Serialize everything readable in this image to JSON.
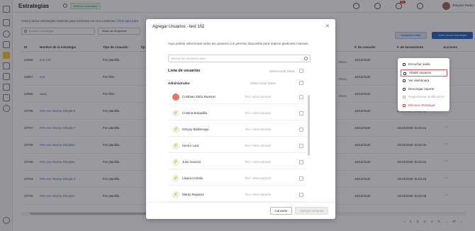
{
  "header": {
    "title": "Estrategias",
    "status_badge": "Teléfono conectado",
    "notification_count": "29",
    "user_name": "Jheyson Pedro"
  },
  "subtitle": {
    "text": "Crea y lanza estrategias masivas para contactar con tus contactos.",
    "link": "Click aquí para"
  },
  "filters": {
    "search_placeholder": "Busca tu estrategia",
    "type_select": "Todas las empresas"
  },
  "actions": {
    "update_label": "Actualizar tabla",
    "create_label": "Crear nueva estrategia"
  },
  "table": {
    "headers": [
      "ID",
      "Nombre de la estrategia",
      "Tipo de creación",
      "Tip",
      "F. de creación",
      "F. de lanzamiento",
      "Acciones"
    ],
    "rows": [
      {
        "id": "22868",
        "name": "test 102",
        "type": "Por plantilla",
        "created": "15/10/2025",
        "launched": "",
        "creator_extra": "Alfaro"
      },
      {
        "id": "22867",
        "name": "test",
        "type": "Por filtro",
        "created": "15/10/2025",
        "launched": "",
        "creator_extra": "Alfaro"
      },
      {
        "id": "22866",
        "name": "aaaa",
        "type": "Por filtro",
        "created": "15/10/2025",
        "launched": "",
        "creator_extra": "Alfaro"
      },
      {
        "id": "22708",
        "name": "IVR con retorno Sheyla 8",
        "type": "Por plantilla",
        "created": "15/10/2025",
        "launched": "15/10/2025 15:52:48",
        "creator_extra": ""
      },
      {
        "id": "22707",
        "name": "IVR con retorno Sheyla 7",
        "type": "Por plantilla",
        "created": "15/10/2025",
        "launched": "15/10/2025 15:52:41",
        "creator_extra": ""
      },
      {
        "id": "22706",
        "name": "IVR con retorno Sheyla6",
        "type": "Por plantilla",
        "created": "15/10/2025",
        "launched": "15/10/2025 15:53:32",
        "creator_extra": ""
      },
      {
        "id": "22705",
        "name": "IVR con retorno Sheyla5",
        "type": "Por plantilla",
        "created": "15/10/2025",
        "launched": "15/10/2025 15:53:24",
        "creator_extra": ""
      },
      {
        "id": "22704",
        "name": "IVR con retorno Sheyla 3",
        "type": "Por plantilla",
        "created": "15/10/2025",
        "launched": "15/10/2025 15:53:16",
        "creator_extra": ""
      },
      {
        "id": "22703",
        "name": "IVR con retorno Sheyla2",
        "type": "Por plantilla",
        "created": "15/10/2025",
        "launched": "15/10/2025 15:53:08",
        "creator_extra": ""
      }
    ]
  },
  "pagination": {
    "pages": [
      "1",
      "2",
      "3",
      "4",
      "5",
      "...",
      "47"
    ]
  },
  "modal": {
    "title": "Agregar Usuarios - test 102",
    "description": "Aquí podrás seleccionar todos los usuarios con permiso disponible para realizar gestiones masivas.",
    "search_placeholder": "Busca los usuarios aquí",
    "list_title": "Lista de usuarios",
    "select_all_label": "Seleccionar todos",
    "group_name": "Administrador",
    "group_select_label": "Seleccionar todos",
    "users": [
      {
        "name": "Cristhian Zafra Ramirez",
        "role": "Rol: Administrador",
        "icon": "photo"
      },
      {
        "name": "Cristina Bobadilla",
        "role": "Rol: Administrador",
        "icon": "user-icon"
      },
      {
        "name": "Greysy Balderrago",
        "role": "Rol: Administrador",
        "icon": "user-icon"
      },
      {
        "name": "Hector Lara",
        "role": "Rol: Administrador",
        "icon": "user-icon"
      },
      {
        "name": "Julio Guerniz",
        "role": "Rol: Administrador",
        "icon": "user-icon"
      },
      {
        "name": "Liliana Uchalin",
        "role": "Rol: Administrador",
        "icon": "user-icon"
      },
      {
        "name": "Martin Reparaz",
        "role": "Rol: Administrador",
        "icon": "user-icon"
      }
    ],
    "cancel_label": "Cancelar",
    "add_label": "Agregar usuarios"
  },
  "context_menu": {
    "items": [
      {
        "label": "Escuchar audio",
        "icon": "play-icon",
        "state": "normal"
      },
      {
        "label": "Añadir usuarios",
        "icon": "user-add-icon",
        "state": "highlight"
      },
      {
        "label": "Ver dashboard",
        "icon": "monitor-icon",
        "state": "normal"
      },
      {
        "label": "Descargar reporte",
        "icon": "download-icon",
        "state": "normal"
      },
      {
        "label": "Reglamentar Notificación",
        "icon": "calendar-icon",
        "state": "disabled"
      },
      {
        "label": "Eliminar estrategia",
        "icon": "trash-icon",
        "state": "danger"
      }
    ]
  },
  "colors": {
    "accent": "#1e63c6",
    "active_nav": "#f3c623",
    "danger": "#d33333"
  }
}
